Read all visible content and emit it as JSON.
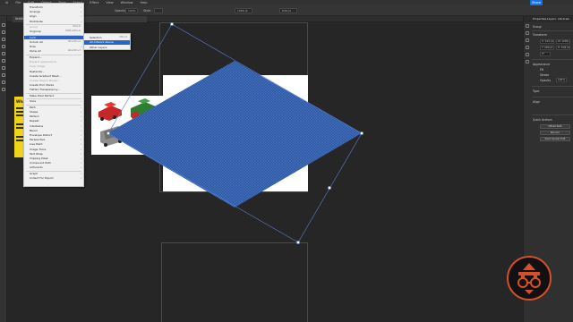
{
  "menubar": {
    "items": [
      "Ai",
      "File",
      "Edit",
      "Object",
      "Type",
      "Select",
      "Effect",
      "View",
      "Window",
      "Help"
    ],
    "share_label": "Share"
  },
  "controlbar": {
    "opacity_label": "Opacity:",
    "opacity_value": "100%",
    "style_label": "Style:",
    "w_value": "1086 pt",
    "h_value": "638 pt"
  },
  "document_tab": "Untitled-1* @ 50% (RGB/CPU Preview)",
  "object_menu": {
    "items": [
      {
        "label": "Transform",
        "shortcut": "",
        "submenu": true,
        "disabled": false
      },
      {
        "label": "Arrange",
        "shortcut": "",
        "submenu": true,
        "disabled": false
      },
      {
        "label": "Align",
        "shortcut": "",
        "submenu": true,
        "disabled": false
      },
      {
        "label": "Distribute",
        "shortcut": "",
        "submenu": true,
        "disabled": false
      },
      {
        "label": "Group",
        "shortcut": "Ctrl+G",
        "submenu": false,
        "disabled": true
      },
      {
        "label": "Ungroup",
        "shortcut": "Shift+Ctrl+G",
        "submenu": false,
        "disabled": false
      },
      {
        "label": "Lock",
        "shortcut": "",
        "submenu": true,
        "disabled": false,
        "selected": true
      },
      {
        "label": "Unlock All",
        "shortcut": "Alt+Ctrl+2",
        "submenu": false,
        "disabled": false
      },
      {
        "label": "Hide",
        "shortcut": "",
        "submenu": true,
        "disabled": false
      },
      {
        "label": "Show All",
        "shortcut": "Alt+Ctrl+3",
        "submenu": false,
        "disabled": false
      },
      {
        "label": "Expand...",
        "shortcut": "",
        "submenu": false,
        "disabled": false
      },
      {
        "label": "Expand Appearance",
        "shortcut": "",
        "submenu": false,
        "disabled": true
      },
      {
        "label": "Crop Image",
        "shortcut": "",
        "submenu": false,
        "disabled": true
      },
      {
        "label": "Rasterize...",
        "shortcut": "",
        "submenu": false,
        "disabled": false
      },
      {
        "label": "Create Gradient Mesh...",
        "shortcut": "",
        "submenu": false,
        "disabled": false
      },
      {
        "label": "Create Object Mosaic...",
        "shortcut": "",
        "submenu": false,
        "disabled": true
      },
      {
        "label": "Create Trim Marks",
        "shortcut": "",
        "submenu": false,
        "disabled": false
      },
      {
        "label": "Flatten Transparency...",
        "shortcut": "",
        "submenu": false,
        "disabled": false
      },
      {
        "label": "Make Pixel Perfect",
        "shortcut": "",
        "submenu": false,
        "disabled": false
      },
      {
        "label": "Slice",
        "shortcut": "",
        "submenu": true,
        "disabled": false
      },
      {
        "label": "Path",
        "shortcut": "",
        "submenu": true,
        "disabled": false
      },
      {
        "label": "Shape",
        "shortcut": "",
        "submenu": true,
        "disabled": false
      },
      {
        "label": "Pattern",
        "shortcut": "",
        "submenu": true,
        "disabled": false
      },
      {
        "label": "Repeat",
        "shortcut": "",
        "submenu": true,
        "disabled": false
      },
      {
        "label": "Intertwine",
        "shortcut": "",
        "submenu": true,
        "disabled": false
      },
      {
        "label": "Blend",
        "shortcut": "",
        "submenu": true,
        "disabled": false
      },
      {
        "label": "Envelope Distort",
        "shortcut": "",
        "submenu": true,
        "disabled": false
      },
      {
        "label": "Perspective",
        "shortcut": "",
        "submenu": true,
        "disabled": false
      },
      {
        "label": "Live Paint",
        "shortcut": "",
        "submenu": true,
        "disabled": false
      },
      {
        "label": "Image Trace",
        "shortcut": "",
        "submenu": true,
        "disabled": false
      },
      {
        "label": "Text Wrap",
        "shortcut": "",
        "submenu": true,
        "disabled": false
      },
      {
        "label": "Clipping Mask",
        "shortcut": "",
        "submenu": true,
        "disabled": false
      },
      {
        "label": "Compound Path",
        "shortcut": "",
        "submenu": true,
        "disabled": false
      },
      {
        "label": "Artboards",
        "shortcut": "",
        "submenu": true,
        "disabled": false
      },
      {
        "label": "Graph",
        "shortcut": "",
        "submenu": true,
        "disabled": false
      },
      {
        "label": "Collect For Export",
        "shortcut": "",
        "submenu": true,
        "disabled": false
      }
    ]
  },
  "lock_submenu": {
    "items": [
      {
        "label": "Selection",
        "shortcut": "Ctrl+2",
        "selected": false
      },
      {
        "label": "All Artwork Above",
        "shortcut": "",
        "selected": true
      },
      {
        "label": "Other Layers",
        "shortcut": "",
        "selected": false
      }
    ]
  },
  "card": {
    "title": "What is"
  },
  "right_panel": {
    "tabs": [
      "Properties",
      "Layers",
      "Libraries"
    ],
    "sections": [
      "Group",
      "Transform",
      "Appearance",
      "Fill",
      "Stroke",
      "Opacity",
      "Type",
      "Align",
      "Quick Actions"
    ],
    "transform": {
      "x": "X: 412 pt",
      "y": "Y: 289 pt",
      "w": "W: 1086 pt",
      "h": "H: 638 pt",
      "angle": "0°"
    },
    "opacity_value": "100%",
    "buttons": [
      "Offset Path",
      "Recolor",
      "Start Global Edit"
    ]
  },
  "colors": {
    "accent": "#2b64c5",
    "diamond": "#2e5aa8",
    "card_yellow": "#f2d31b",
    "logo_ring": "#d5502a"
  },
  "icons": [
    "selection-tool-icon",
    "direct-selection-tool-icon",
    "pen-tool-icon",
    "type-tool-icon",
    "rectangle-tool-icon",
    "brush-tool-icon",
    "rotate-tool-icon",
    "scale-tool-icon",
    "hand-tool-icon",
    "zoom-tool-icon"
  ]
}
